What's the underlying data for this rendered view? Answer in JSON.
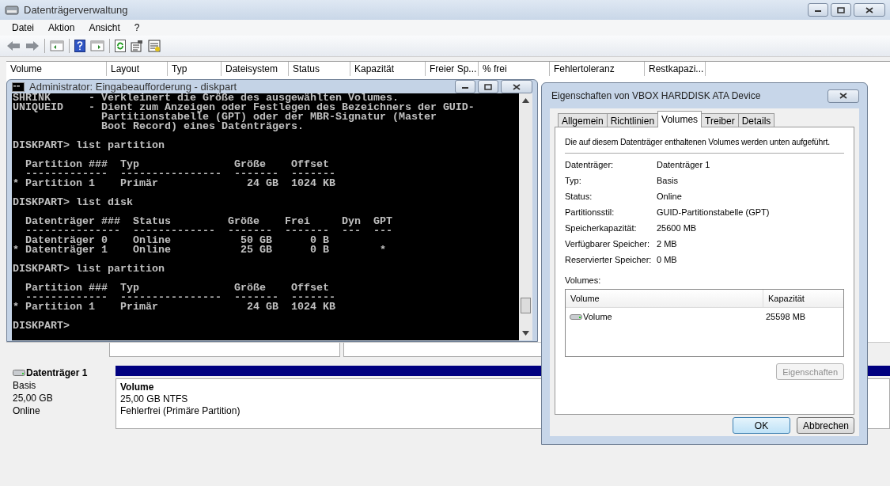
{
  "window": {
    "title": "Datenträgerverwaltung"
  },
  "menu": [
    "Datei",
    "Aktion",
    "Ansicht",
    "?"
  ],
  "volume_table": {
    "columns": [
      "Volume",
      "Layout",
      "Typ",
      "Dateisystem",
      "Status",
      "Kapazität",
      "Freier Sp...",
      "% frei",
      "Fehlertoleranz",
      "Restkapazi..."
    ]
  },
  "disk": {
    "name": "Datenträger 1",
    "type": "Basis",
    "size": "25,00 GB",
    "status": "Online",
    "partition": {
      "name": "Volume",
      "size_fs": "25,00 GB NTFS",
      "state": "Fehlerfrei (Primäre Partition)"
    }
  },
  "console": {
    "title": "Administrator: Eingabeaufforderung - diskpart",
    "blocks": [
      [
        "SHRINK      - Verkleinert die Größe des ausgewählten Volumes.",
        "UNIQUEID    - Dient zum Anzeigen oder Festlegen des Bezeichners der GUID-",
        "              Partitionstabelle (GPT) oder der MBR-Signatur (Master",
        "              Boot Record) eines Datenträgers."
      ],
      [
        "DISKPART> list partition"
      ],
      [
        "  Partition ###  Typ               Größe    Offset",
        "  -------------  ----------------  -------  -------",
        "* Partition 1    Primär              24 GB  1024 KB"
      ],
      [
        "DISKPART> list disk"
      ],
      [
        "  Datenträger ###  Status         Größe    Frei     Dyn  GPT",
        "  ---------------  -------------  -------  -------  ---  ---",
        "  Datenträger 0    Online           50 GB      0 B",
        "* Datenträger 1    Online           25 GB      0 B        *"
      ],
      [
        "DISKPART> list partition"
      ],
      [
        "  Partition ###  Typ               Größe    Offset",
        "  -------------  ----------------  -------  -------",
        "* Partition 1    Primär              24 GB  1024 KB"
      ],
      [
        "DISKPART>"
      ]
    ]
  },
  "dialog": {
    "title": "Eigenschaften von VBOX HARDDISK ATA Device",
    "tabs": [
      {
        "label": "Allgemein",
        "selected": false
      },
      {
        "label": "Richtlinien",
        "selected": false
      },
      {
        "label": "Volumes",
        "selected": true
      },
      {
        "label": "Treiber",
        "selected": false
      },
      {
        "label": "Details",
        "selected": false
      }
    ],
    "description": "Die auf diesem Datenträger enthaltenen Volumes werden unten aufgeführt.",
    "properties": [
      {
        "label": "Datenträger:",
        "value": "Datenträger 1"
      },
      {
        "label": "Typ:",
        "value": "Basis"
      },
      {
        "label": "Status:",
        "value": "Online"
      },
      {
        "label": "Partitionsstil:",
        "value": "GUID-Partitionstabelle (GPT)"
      },
      {
        "label": "Speicherkapazität:",
        "value": "25600 MB"
      },
      {
        "label": "Verfügbarer Speicher:",
        "value": "2 MB"
      },
      {
        "label": "Reservierter Speicher:",
        "value": "0 MB"
      }
    ],
    "volumes_label": "Volumes:",
    "volumes_table": {
      "columns": [
        "Volume",
        "Kapazität"
      ],
      "rows": [
        {
          "name": "Volume",
          "capacity": "25598 MB"
        }
      ]
    },
    "properties_button": {
      "label": "Eigenschaften",
      "disabled": true
    },
    "buttons": [
      {
        "label": "OK",
        "default": true
      },
      {
        "label": "Abbrechen",
        "default": false
      }
    ]
  }
}
